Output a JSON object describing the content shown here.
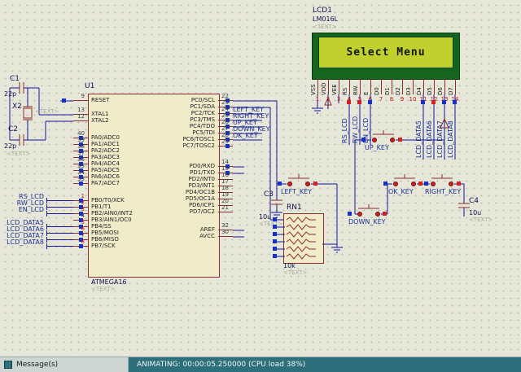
{
  "app": {
    "messages_tab": "Message(s)",
    "status_text": "ANIMATING: 00:00:05.250000 (CPU load 38%)"
  },
  "lcd": {
    "ref": "LCD1",
    "part": "LM016L",
    "placeholder": "<TEXT>",
    "screen_text": "Select Menu",
    "pins": [
      {
        "num": "1",
        "name": "VSS"
      },
      {
        "num": "2",
        "name": "VDD"
      },
      {
        "num": "3",
        "name": "VEE"
      },
      {
        "num": "4",
        "name": "RS"
      },
      {
        "num": "5",
        "name": "RW"
      },
      {
        "num": "6",
        "name": "E"
      },
      {
        "num": "7",
        "name": "D0"
      },
      {
        "num": "8",
        "name": "D1"
      },
      {
        "num": "9",
        "name": "D2"
      },
      {
        "num": "10",
        "name": "D3"
      },
      {
        "num": "11",
        "name": "D4"
      },
      {
        "num": "12",
        "name": "D5"
      },
      {
        "num": "13",
        "name": "D6"
      },
      {
        "num": "14",
        "name": "D7"
      }
    ]
  },
  "mcu": {
    "ref": "U1",
    "part": "ATMEGA16",
    "placeholder": "<TEXT>",
    "left_pins": [
      {
        "num": "9",
        "name": "RESET"
      },
      {
        "num": "13",
        "name": "XTAL1"
      },
      {
        "num": "12",
        "name": "XTAL2"
      },
      {
        "num": "40",
        "name": "PA0/ADC0"
      },
      {
        "num": "39",
        "name": "PA1/ADC1"
      },
      {
        "num": "38",
        "name": "PA2/ADC2"
      },
      {
        "num": "37",
        "name": "PA3/ADC3"
      },
      {
        "num": "36",
        "name": "PA4/ADC4"
      },
      {
        "num": "35",
        "name": "PA5/ADC5"
      },
      {
        "num": "34",
        "name": "PA6/ADC6"
      },
      {
        "num": "33",
        "name": "PA7/ADC7"
      },
      {
        "num": "1",
        "name": "PB0/T0/XCK"
      },
      {
        "num": "2",
        "name": "PB1/T1"
      },
      {
        "num": "3",
        "name": "PB2/AIN0/INT2"
      },
      {
        "num": "4",
        "name": "PB3/AIN1/OC0"
      },
      {
        "num": "5",
        "name": "PB4/SS"
      },
      {
        "num": "6",
        "name": "PB5/MOSI"
      },
      {
        "num": "7",
        "name": "PB6/MISO"
      },
      {
        "num": "8",
        "name": "PB7/SCK"
      }
    ],
    "right_pins": [
      {
        "num": "22",
        "name": "PC0/SCL"
      },
      {
        "num": "23",
        "name": "PC1/SDA"
      },
      {
        "num": "24",
        "name": "PC2/TCK"
      },
      {
        "num": "25",
        "name": "PC3/TMS"
      },
      {
        "num": "26",
        "name": "PC4/TDO"
      },
      {
        "num": "27",
        "name": "PC5/TDI"
      },
      {
        "num": "28",
        "name": "PC6/TOSC1"
      },
      {
        "num": "29",
        "name": "PC7/TOSC2"
      },
      {
        "num": "14",
        "name": "PD0/RXD"
      },
      {
        "num": "15",
        "name": "PD1/TXD"
      },
      {
        "num": "16",
        "name": "PD2/INT0"
      },
      {
        "num": "17",
        "name": "PD3/INT1"
      },
      {
        "num": "18",
        "name": "PD4/OC1B"
      },
      {
        "num": "19",
        "name": "PD5/OC1A"
      },
      {
        "num": "20",
        "name": "PD6/ICP1"
      },
      {
        "num": "21",
        "name": "PD7/OC2"
      },
      {
        "num": "32",
        "name": "AREF"
      },
      {
        "num": "30",
        "name": "AVCC"
      }
    ]
  },
  "oscillator": {
    "c1_ref": "C1",
    "c1_value": "22p",
    "c2_ref": "C2",
    "c2_value": "22p",
    "c2_placeholder": "<TEXT>",
    "x2_ref": "X2",
    "x2_placeholder": "<TEXT>"
  },
  "left_terminals": [
    {
      "label": "RS_LCD"
    },
    {
      "label": "RW_LCD"
    },
    {
      "label": "EN_LCD"
    },
    {
      "label": "LCD_DATA5"
    },
    {
      "label": "LCD_DATA6"
    },
    {
      "label": "LCD_DATA7"
    },
    {
      "label": "LCD_DATA8"
    }
  ],
  "right_nets": [
    "LEFT_KEY",
    "RIGHT_KEY",
    "UP_KEY",
    "DOWN_KEY",
    "OK_KEY"
  ],
  "vertical_nets": [
    "RS_LCD",
    "RW_LCD",
    "EN_LCD",
    "LCD_DATA5",
    "LCD_DATA6",
    "LCD_DATA7",
    "LCD_DATA8"
  ],
  "buttons": [
    {
      "label": "UP_KEY"
    },
    {
      "label": "LEFT_KEY"
    },
    {
      "label": "OK_KEY"
    },
    {
      "label": "RIGHT_KEY"
    },
    {
      "label": "DOWN_KEY"
    }
  ],
  "c3": {
    "ref": "C3",
    "value": "10u",
    "placeholder": "<TEXT>"
  },
  "c4": {
    "ref": "C4",
    "value": "10u",
    "placeholder": "<TEXT>"
  },
  "rn1": {
    "ref": "RN1",
    "value": "10k",
    "placeholder": "<TEXT>"
  }
}
